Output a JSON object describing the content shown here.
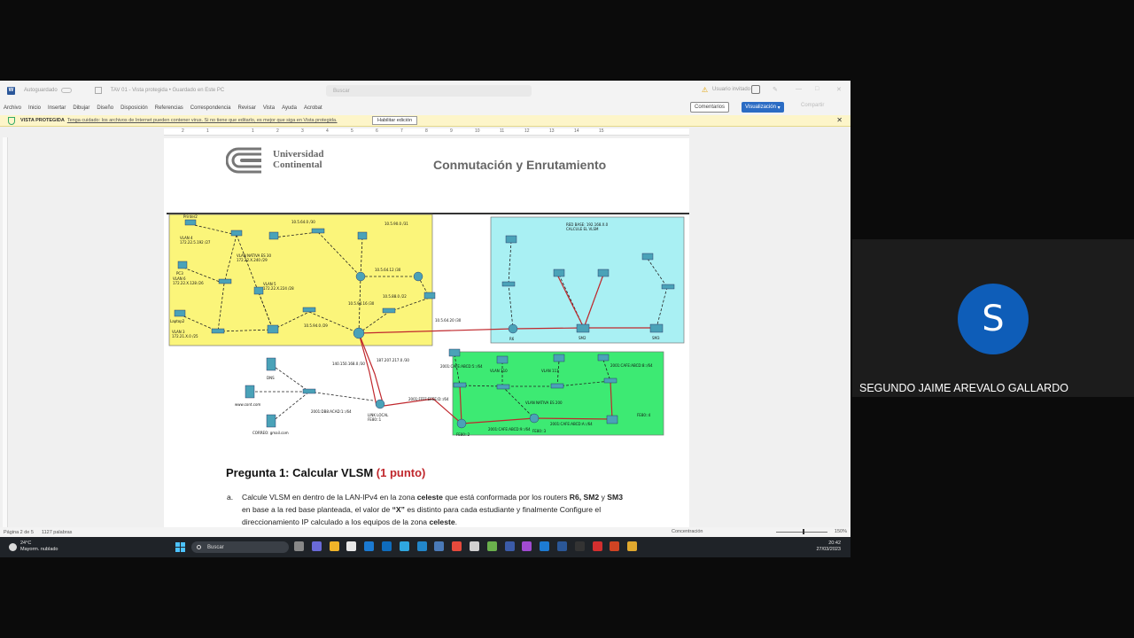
{
  "word": {
    "autosave": "Autoguardado",
    "doc_title": "TAV 01 - Vista protegida • Guardado en Este PC",
    "search_placeholder": "Buscar",
    "user_name": "Usuario invitado",
    "menu": [
      "Archivo",
      "Inicio",
      "Insertar",
      "Dibujar",
      "Diseño",
      "Disposición",
      "Referencias",
      "Correspondencia",
      "Revisar",
      "Vista",
      "Ayuda",
      "Acrobat"
    ],
    "comments_label": "Comentarios",
    "view_label": "Visualización",
    "share_label": "Compartir",
    "protected": {
      "label": "VISTA PROTEGIDA",
      "message": "Tenga cuidado: los archivos de Internet pueden contener virus. Si no tiene que editarlo, es mejor que siga en Vista protegida.",
      "enable_button": "Habilitar edición"
    },
    "ruler_numbers": [
      "1",
      "2",
      "1",
      "2",
      "3",
      "4",
      "5",
      "6",
      "7",
      "8",
      "9",
      "10",
      "11",
      "12",
      "13",
      "14",
      "15"
    ],
    "status": {
      "page": "Página 2 de 5",
      "words": "1127 palabras",
      "focus": "Concentración",
      "zoom": "150%"
    }
  },
  "document": {
    "university_line1": "Universidad",
    "university_line2": "Continental",
    "course_title": "Conmutación y Enrutamiento",
    "question_title": "Pregunta 1: Calcular VLSM",
    "question_points": "(1 punto)",
    "item_letter": "a.",
    "item_text_1": "Calcule VLSM en dentro de la LAN-IPv4 en la zona ",
    "item_bold_1": "celeste",
    "item_text_2": " que está conformada por los routers ",
    "item_bold_2": "R6, SM2",
    "item_text_3": " y ",
    "item_bold_3": "SM3",
    "item_text_4": " en base a la red base planteada, el valor de ",
    "item_bold_4": "“X”",
    "item_text_5": " es distinto para cada estudiante y finalmente Configure el direccionamiento IP calculado a los equipos de la zona ",
    "item_bold_5": "celeste",
    "item_text_6": ".",
    "diagram_labels": {
      "printer": "Printer2",
      "vlan4": "VLAN 4",
      "vlan4_net": "172.22.5.192 /27",
      "native": "VLAN NATIVA ES 30",
      "native_net": "172.22.X.240 /29",
      "pc3": "PC3",
      "vlan6": "VLAN 6",
      "vlan6_net": "172.22.X.128 /26",
      "vlan5": "VLAN 5",
      "vlan5_net": "172.22.X.224 /28",
      "laptop2": "Laptop2",
      "vlan3": "VLAN 3",
      "vlan3_net": "172.21.X.0 /25",
      "net1": "10.5.64.0 /30",
      "net2": "10.5.90.0 /31",
      "net3": "10.5.64.12 /30",
      "net4": "10.5.88.0 /22",
      "net5": "10.5.94.16 /30",
      "net6": "10.5.94.0 /29",
      "net7": "10.5.64.20 /30",
      "net8": "140.150.168.0 /30",
      "net9": "187.207.217.0 /30",
      "base": "RED BASE: 192.168.X.0",
      "calc": "CALCULE EL VLSM",
      "dns": "DNS",
      "web": "www.cont.com",
      "mail": "CORREO: gmail.com",
      "link": "LINK LOCAL",
      "fe80": "FE80::1",
      "ipv6a": "2001:FFFF:EEEE:D::/64",
      "ipv6b": "2001:DB8:ACAD:1::/64",
      "ipv6c": "2001:CAFE:ABCD:5::/64",
      "ipv6d": "2001:CAFE:ABCD:8::/64",
      "ipv6e": "2001:CAFE:ABCD:9::/64",
      "ipv6f": "2001:CAFE:ABCD:A::/64",
      "vlan_native_200": "VLAN NATIVA ES 200",
      "fe80_4": "FE80::4",
      "fe80_2": "FE80::2",
      "fe80_3": "FE80::3",
      "vlan110": "VLAN 110",
      "vlan111": "VLAN 111",
      "r6": "R6",
      "sm2": "SM2",
      "sm3": "SM3"
    }
  },
  "taskbar": {
    "temperature": "24°C",
    "weather": "Mayorm. nublado",
    "search": "Buscar",
    "time": "20:42",
    "date": "27/03/2023"
  },
  "participant": {
    "initial": "S",
    "name": "SEGUNDO JAIME AREVALO GALLARDO"
  },
  "colors": {
    "word_blue": "#2b579a",
    "avatar_blue": "#0e5db8",
    "yellow_zone": "#fbf57a",
    "cyan_zone": "#a9f0f3",
    "green_zone": "#3dea73",
    "points_red": "#c0282d"
  }
}
